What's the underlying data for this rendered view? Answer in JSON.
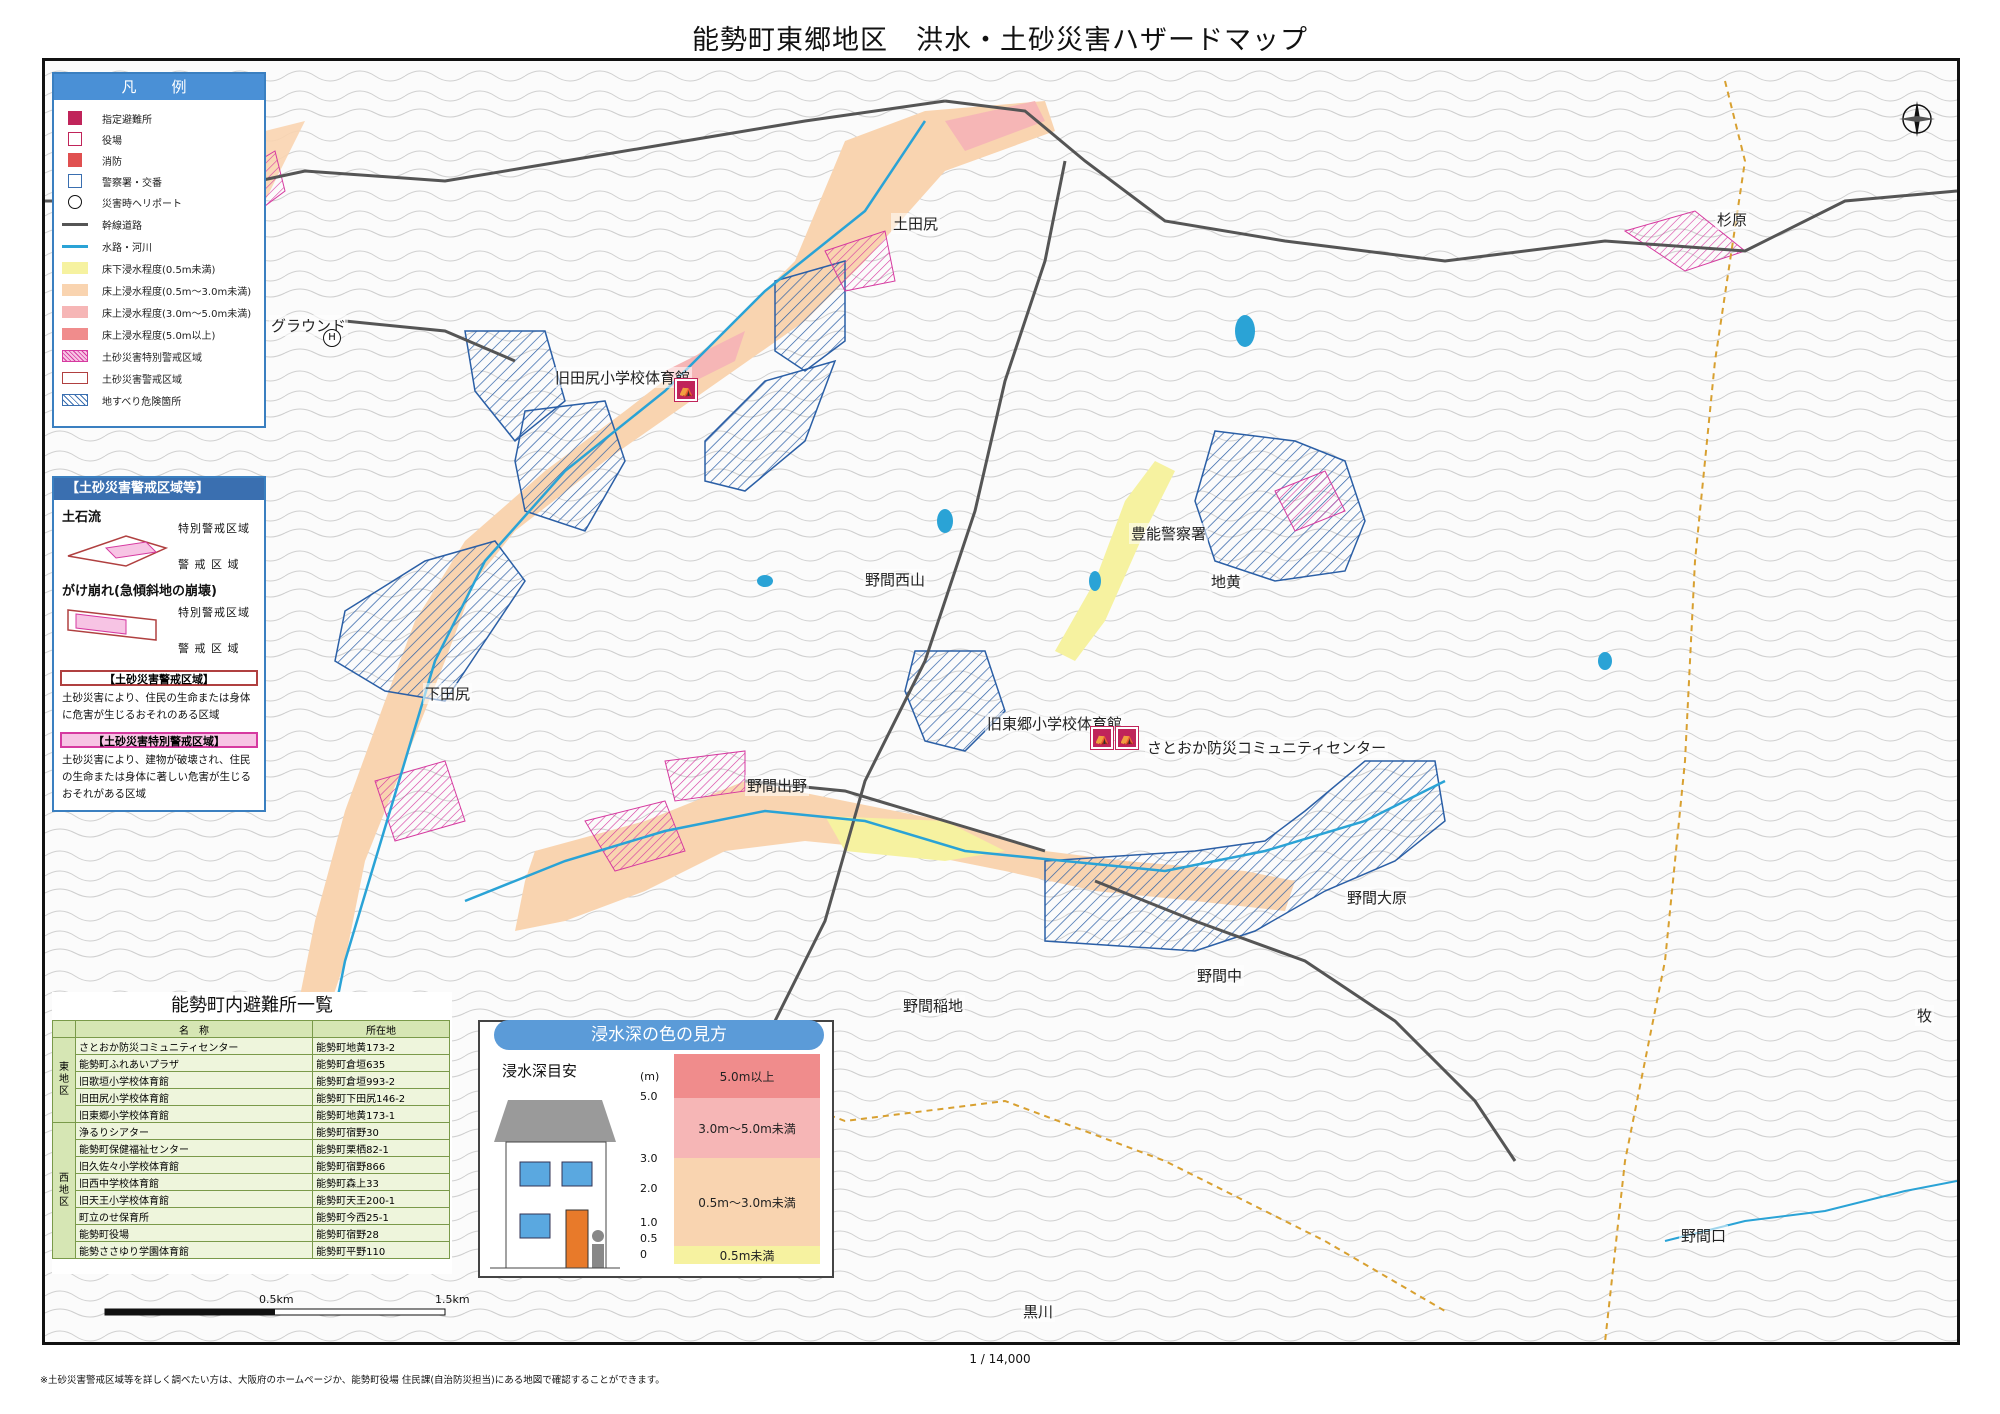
{
  "title": "能勢町東郷地区　洪水・土砂災害ハザードマップ",
  "scale_ratio": "1 / 14,000",
  "footnote": "※土砂災害警戒区域等を詳しく調べたい方は、大阪府のホームページか、能勢町役場 住民課(自治防災担当)にある地図で確認することができます。",
  "map": {
    "places": [
      "旧田尻小学校体育館",
      "土田尻",
      "杉原",
      "豊能警察署",
      "地黄",
      "野間西山",
      "旧東郷小学校体育館",
      "さとおか防災コミュニティセンター",
      "下田尻",
      "野間出野",
      "野間大原",
      "野間中",
      "野間稲地",
      "野間口",
      "黒川",
      "牧",
      "グラウンド"
    ],
    "scale_bar": {
      "mid": "0.5km",
      "end": "1.5km"
    }
  },
  "legend": {
    "title": "凡　例",
    "items": [
      {
        "label": "指定避難所",
        "icon": "shelter-icon"
      },
      {
        "label": "役場",
        "icon": "townhall-icon"
      },
      {
        "label": "消防",
        "icon": "fire-station-icon"
      },
      {
        "label": "警察署・交番",
        "icon": "police-icon"
      },
      {
        "label": "災害時ヘリポート",
        "icon": "heliport-icon"
      },
      {
        "label": "幹線道路",
        "icon": "road-line"
      },
      {
        "label": "水路・河川",
        "icon": "river-line"
      },
      {
        "label": "床下浸水程度(0.5m未満)",
        "color": "#f6f2a0"
      },
      {
        "label": "床上浸水程度(0.5m〜3.0m未満)",
        "color": "#f9d4b0"
      },
      {
        "label": "床上浸水程度(3.0m〜5.0m未満)",
        "color": "#f6b6b6"
      },
      {
        "label": "床上浸水程度(5.0m以上)",
        "color": "#f08c8c"
      },
      {
        "label": "土砂災害特別警戒区域",
        "color": "#e84fb2"
      },
      {
        "label": "土砂災害警戒区域",
        "color": "#b04040"
      },
      {
        "label": "地すべり危険箇所",
        "color": "#3a6fb0"
      }
    ]
  },
  "sediment_panel": {
    "title": "【土砂災害警戒区域等】",
    "debris_flow": "土石流",
    "slope_failure": "がけ崩れ(急傾斜地の崩壊)",
    "special_zone": "特別警戒区域",
    "warning_zone": "警 戒 区 域",
    "warning_box": "【土砂災害警戒区域】",
    "warning_desc": "土砂災害により、住民の生命または身体に危害が生じるおそれのある区域",
    "special_box": "【土砂災害特別警戒区域】",
    "special_desc": "土砂災害により、建物が破壊され、住民の生命または身体に著しい危害が生じるおそれがある区域"
  },
  "shelter_list": {
    "title": "能勢町内避難所一覧",
    "headers": [
      "名　称",
      "所在地"
    ],
    "east_region": "東地区",
    "west_region": "西地区",
    "east": [
      [
        "さとおか防災コミュニティセンター",
        "能勢町地黄173-2"
      ],
      [
        "能勢町ふれあいプラザ",
        "能勢町倉垣635"
      ],
      [
        "旧歌垣小学校体育館",
        "能勢町倉垣993-2"
      ],
      [
        "旧田尻小学校体育館",
        "能勢町下田尻146-2"
      ],
      [
        "旧東郷小学校体育館",
        "能勢町地黄173-1"
      ]
    ],
    "west": [
      [
        "浄るりシアター",
        "能勢町宿野30"
      ],
      [
        "能勢町保健福祉センター",
        "能勢町栗栖82-1"
      ],
      [
        "旧久佐々小学校体育館",
        "能勢町宿野866"
      ],
      [
        "旧西中学校体育館",
        "能勢町森上33"
      ],
      [
        "旧天王小学校体育館",
        "能勢町天王200-1"
      ],
      [
        "町立のせ保育所",
        "能勢町今西25-1"
      ],
      [
        "能勢町役場",
        "能勢町宿野28"
      ],
      [
        "能勢ささゆり学園体育館",
        "能勢町平野110"
      ]
    ]
  },
  "depth_guide": {
    "title": "浸水深の色の見方",
    "subtitle": "浸水深目安",
    "unit": "(m)",
    "ticks": [
      "5.0",
      "3.0",
      "2.0",
      "1.0",
      "0.5",
      "0"
    ],
    "bands": [
      {
        "label": "5.0m以上",
        "color": "#f08c8c"
      },
      {
        "label": "3.0m〜5.0m未満",
        "color": "#f6b6b6"
      },
      {
        "label": "0.5m〜3.0m未満",
        "color": "#f9d4b0"
      },
      {
        "label": "0.5m未満",
        "color": "#f6f2a0"
      }
    ]
  }
}
